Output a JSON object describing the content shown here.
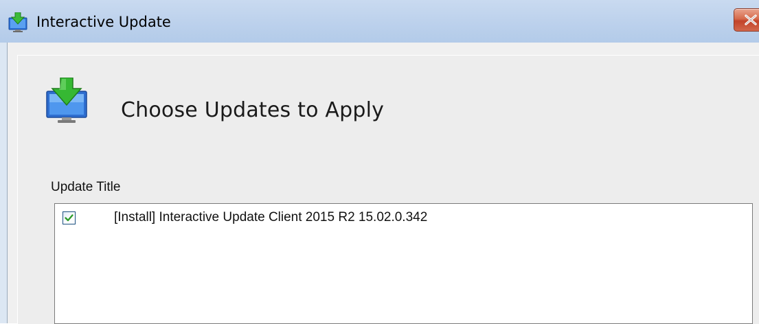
{
  "window": {
    "title": "Interactive Update",
    "title_icon": "update-monitor-icon",
    "close_icon": "close-icon"
  },
  "header": {
    "icon": "download-to-monitor-icon",
    "heading": "Choose Updates to Apply"
  },
  "updates_list": {
    "column_header": "Update Title",
    "items": [
      {
        "checked": true,
        "title": "[Install] Interactive Update Client 2015 R2 15.02.0.342"
      }
    ]
  },
  "colors": {
    "titlebar": "#bcd1ec",
    "close_button": "#c2432a",
    "arrow_green": "#34b233",
    "monitor_blue": "#2a6fd6"
  }
}
